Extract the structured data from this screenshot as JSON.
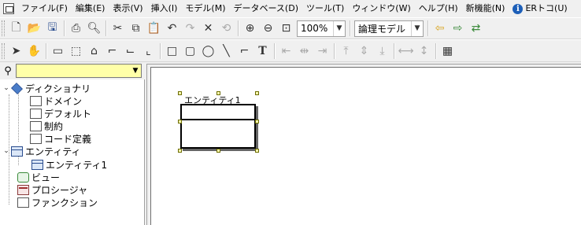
{
  "menu": [
    "ファイル(F)",
    "編集(E)",
    "表示(V)",
    "挿入(I)",
    "モデル(M)",
    "データベース(D)",
    "ツール(T)",
    "ウィンドウ(W)",
    "ヘルプ(H)",
    "新機能(N)"
  ],
  "menu_info": "ERトコ(U)",
  "toolbar1": {
    "zoom": "100%",
    "model_select": "論理モデル"
  },
  "toolbar2": {
    "text_tool": "T"
  },
  "tree": {
    "search_value": "",
    "dictionary": "ディクショナリ",
    "domain": "ドメイン",
    "default": "デフォルト",
    "constraint": "制約",
    "code_def": "コード定義",
    "entities": "エンティティ",
    "entity1": "エンティティ1",
    "view": "ビュー",
    "procedure": "プロシージャ",
    "function": "ファンクション"
  },
  "canvas": {
    "entity_name": "エンティティ1"
  }
}
